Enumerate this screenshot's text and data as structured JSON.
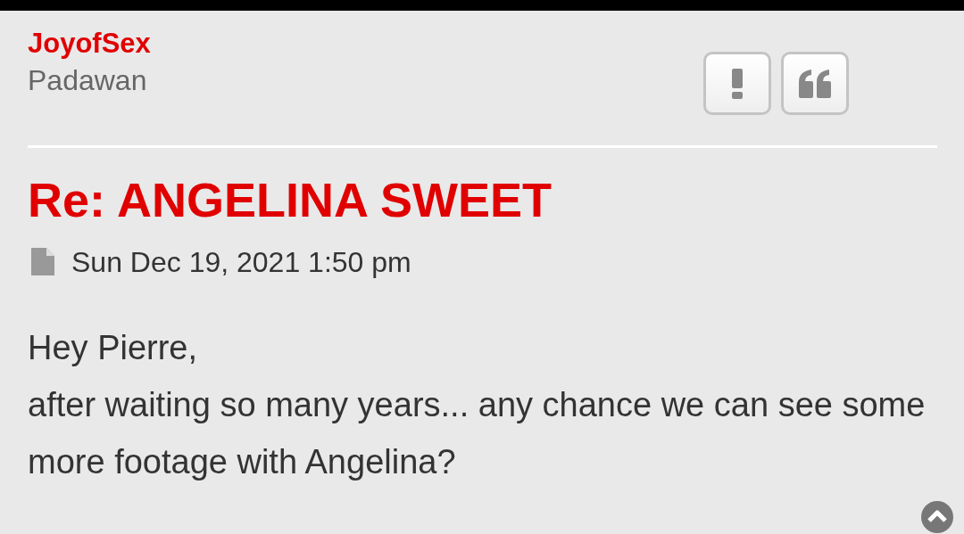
{
  "post": {
    "author": "JoyofSex",
    "rank": "Padawan",
    "title": "Re: ANGELINA SWEET",
    "date": "Sun Dec 19, 2021 1:50 pm",
    "body": [
      "Hey Pierre,",
      "after waiting so many years... any chance we can see some more footage with Angelina?"
    ]
  }
}
